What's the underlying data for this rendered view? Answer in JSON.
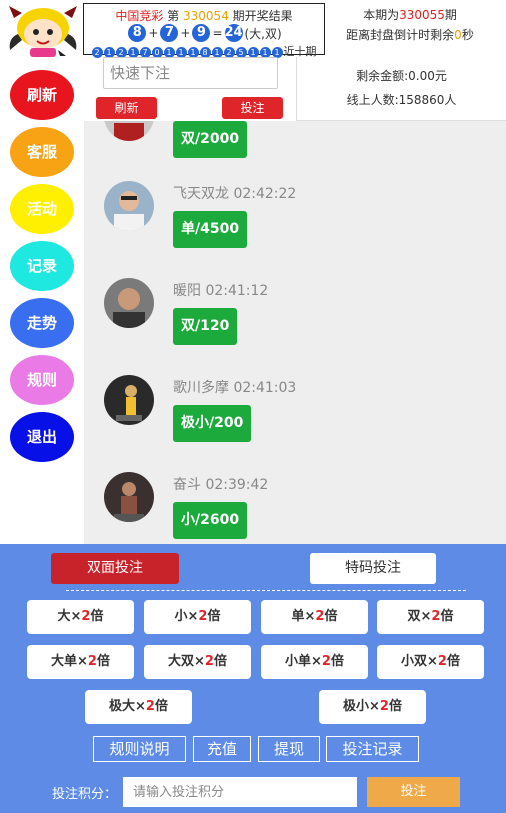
{
  "header": {
    "brand": "中国竞彩",
    "issue_prefix": "第",
    "last_issue": "330054",
    "issue_suffix": "期开奖结果",
    "balls": [
      "8",
      "7",
      "9"
    ],
    "sum": "24",
    "result": "(大,双)",
    "history_digits": [
      "2",
      "1",
      "2",
      "1",
      "7",
      "0",
      "1",
      "1",
      "1",
      "8",
      "1",
      "2",
      "5",
      "1",
      "1",
      "1"
    ],
    "history_label": "近十期",
    "current_prefix": "本期为",
    "current_issue": "330055",
    "current_suffix": "期",
    "countdown_prefix": "距离封盘倒计时剩余",
    "countdown_value": "0",
    "countdown_suffix": "秒"
  },
  "quick_bet": {
    "placeholder": "快速下注",
    "refresh_label": "刷新",
    "bet_label": "投注"
  },
  "info": {
    "balance_label": "剩余金额:",
    "balance_value": "0.00元",
    "online_label": "线上人数:",
    "online_value": "158860人"
  },
  "sidebar": [
    {
      "label": "刷新",
      "color": "#e8141e"
    },
    {
      "label": "客服",
      "color": "#f7a313"
    },
    {
      "label": "活动",
      "color": "#ffef00"
    },
    {
      "label": "记录",
      "color": "#1ee8e0"
    },
    {
      "label": "走势",
      "color": "#3a6ef0"
    },
    {
      "label": "规则",
      "color": "#ea7be6"
    },
    {
      "label": "退出",
      "color": "#0810e8"
    }
  ],
  "messages": [
    {
      "name": "",
      "time": "",
      "bet": "双/2000"
    },
    {
      "name": "飞天双龙",
      "time": "02:42:22",
      "bet": "单/4500"
    },
    {
      "name": "暖阳",
      "time": "02:41:12",
      "bet": "双/120"
    },
    {
      "name": "歌川多摩",
      "time": "02:41:03",
      "bet": "极小/200"
    },
    {
      "name": "奋斗",
      "time": "02:39:42",
      "bet": "小/2600"
    }
  ],
  "tabs": {
    "active": "双面投注",
    "idle": "特码投注"
  },
  "bets": [
    {
      "name": "大",
      "mult": "2",
      "unit": "倍"
    },
    {
      "name": "小",
      "mult": "2",
      "unit": "倍"
    },
    {
      "name": "单",
      "mult": "2",
      "unit": "倍"
    },
    {
      "name": "双",
      "mult": "2",
      "unit": "倍"
    },
    {
      "name": "大单",
      "mult": "2",
      "unit": "倍"
    },
    {
      "name": "大双",
      "mult": "2",
      "unit": "倍"
    },
    {
      "name": "小单",
      "mult": "2",
      "unit": "倍"
    },
    {
      "name": "小双",
      "mult": "2",
      "unit": "倍"
    },
    {
      "name": "极大",
      "mult": "2",
      "unit": "倍"
    },
    {
      "name": "极小",
      "mult": "2",
      "unit": "倍"
    }
  ],
  "times_sign": "×",
  "links": [
    "规则说明",
    "充值",
    "提现",
    "投注记录"
  ],
  "score": {
    "label": "投注积分：",
    "placeholder": "请输入投注积分",
    "submit": "投注"
  },
  "colors": {
    "panel": "#5d8be6",
    "bubble": "#1daa3c",
    "accent_red": "#e0252a"
  }
}
